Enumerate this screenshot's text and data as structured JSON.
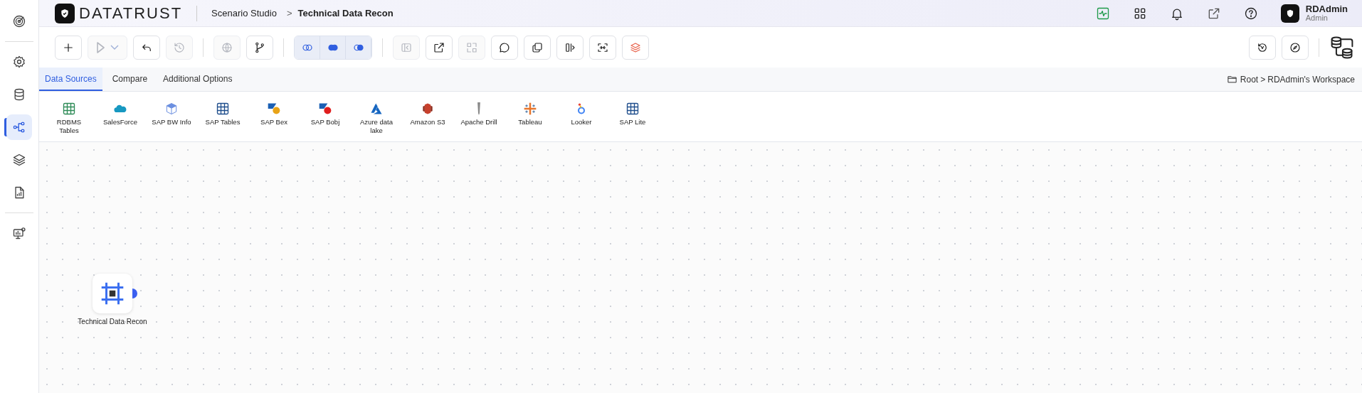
{
  "sidebar": {
    "items": [
      {
        "kind": "target",
        "selected": false
      },
      {
        "kind": "gear",
        "selected": false
      },
      {
        "kind": "database",
        "selected": false
      },
      {
        "kind": "flow",
        "selected": true
      },
      {
        "kind": "layers",
        "selected": false
      },
      {
        "kind": "report",
        "selected": false
      },
      {
        "kind": "monitor",
        "selected": false
      }
    ]
  },
  "header": {
    "logo": "DATATRUST",
    "breadcrumb": [
      "Scenario Studio",
      "Technical Data Recon"
    ],
    "separator": ">",
    "icons": [
      {
        "kind": "activity"
      },
      {
        "kind": "apps"
      },
      {
        "kind": "bell"
      },
      {
        "kind": "external"
      },
      {
        "kind": "help"
      }
    ],
    "user": {
      "name": "RDAdmin",
      "role": "Admin"
    }
  },
  "toolbar": {
    "groups": [
      {
        "kind": "plain",
        "buttons": [
          {
            "kind": "plus",
            "disabled": false
          },
          {
            "kind": "play",
            "disabled": true
          },
          {
            "kind": "undo",
            "disabled": false
          },
          {
            "kind": "history",
            "disabled": true
          }
        ]
      },
      {
        "kind": "plain",
        "buttons": [
          {
            "kind": "globe",
            "disabled": true
          },
          {
            "kind": "branch",
            "disabled": false
          }
        ]
      },
      {
        "kind": "segmented",
        "buttons": [
          {
            "kind": "join-inner",
            "disabled": false
          },
          {
            "kind": "join-left",
            "disabled": false
          },
          {
            "kind": "join-right",
            "disabled": false
          }
        ]
      },
      {
        "kind": "plain",
        "buttons": [
          {
            "kind": "collapse",
            "disabled": true
          },
          {
            "kind": "external",
            "disabled": false
          },
          {
            "kind": "select",
            "disabled": true
          },
          {
            "kind": "comment",
            "disabled": false
          },
          {
            "kind": "copy",
            "disabled": false
          },
          {
            "kind": "split",
            "disabled": false
          },
          {
            "kind": "merge",
            "disabled": false
          },
          {
            "kind": "stack",
            "disabled": false
          }
        ]
      }
    ],
    "right": [
      {
        "kind": "version"
      },
      {
        "kind": "compass"
      }
    ]
  },
  "tabs": [
    {
      "label": "Data Sources",
      "selected": true
    },
    {
      "label": "Compare",
      "selected": false
    },
    {
      "label": "Additional Options",
      "selected": false
    }
  ],
  "location": {
    "root": "Root",
    "separator": ">",
    "workspace": "RDAdmin's Workspace"
  },
  "data_sources": [
    {
      "label": "RDBMS Tables",
      "kind": "table",
      "color": "#2e8b57"
    },
    {
      "label": "SalesForce",
      "kind": "cloud",
      "color": "#1798c1"
    },
    {
      "label": "SAP BW Info",
      "kind": "cube",
      "color": "#6b8fe0"
    },
    {
      "label": "SAP Tables",
      "kind": "table",
      "color": "#1f4e8c"
    },
    {
      "label": "SAP Bex",
      "kind": "sap",
      "color": "#e8a317"
    },
    {
      "label": "SAP Bobj",
      "kind": "sap",
      "color": "#e01e1e"
    },
    {
      "label": "Azure data lake",
      "kind": "azure",
      "color": "#1565c0"
    },
    {
      "label": "Amazon S3",
      "kind": "s3",
      "color": "#c7402c"
    },
    {
      "label": "Apache Drill",
      "kind": "drill",
      "color": "#8a8a8a"
    },
    {
      "label": "Tableau",
      "kind": "tableau",
      "color": "#e8762c"
    },
    {
      "label": "Looker",
      "kind": "looker",
      "color": "#4285f4"
    },
    {
      "label": "SAP Lite",
      "kind": "table",
      "color": "#1f4e8c"
    }
  ],
  "canvas": {
    "nodes": [
      {
        "label": "Technical Data Recon",
        "port": true
      }
    ]
  }
}
